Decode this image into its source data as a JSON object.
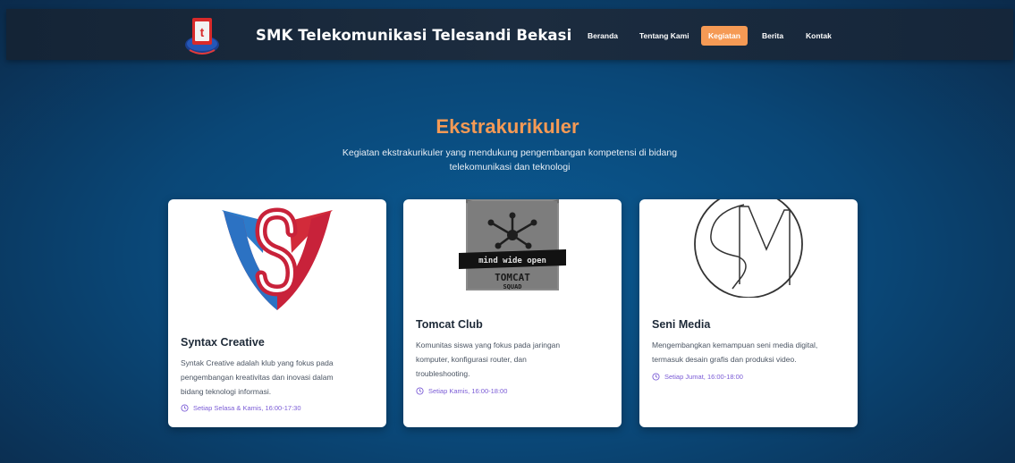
{
  "header": {
    "brand": "SMK Telekomunikasi Telesandi Bekasi",
    "logo_icon": "school-logo-icon",
    "nav": [
      {
        "label": "Beranda",
        "active": false
      },
      {
        "label": "Tentang Kami",
        "active": false
      },
      {
        "label": "Kegiatan",
        "active": true
      },
      {
        "label": "Berita",
        "active": false
      },
      {
        "label": "Kontak",
        "active": false
      }
    ]
  },
  "hero": {
    "title": "Ekstrakurikuler",
    "subtitle_line1": "Kegiatan ekstrakurikuler yang mendukung pengembangan kompetensi di bidang",
    "subtitle_line2": "telekomunikasi dan teknologi"
  },
  "cards": [
    {
      "title": "Syntax Creative",
      "desc_lines": [
        "Syntak Creative adalah klub yang fokus pada",
        "pengembangan kreativitas dan inovasi dalam",
        "bidang teknologi informasi."
      ],
      "schedule": "Setiap Selasa & Kamis, 16:00-17:30",
      "image_icon": "syntax-creative-logo"
    },
    {
      "title": "Tomcat Club",
      "desc_lines": [
        "Komunitas siswa yang fokus pada jaringan",
        "komputer, konfigurasi router, dan",
        "troubleshooting."
      ],
      "schedule": "Setiap Kamis, 16:00-18:00",
      "image_icon": "tomcat-squad-logo",
      "image_text": [
        "mind wide open",
        "TOMCAT",
        "SQUAD"
      ]
    },
    {
      "title": "Seni Media",
      "desc_lines": [
        "Mengembangkan kemampuan seni media digital,",
        "termasuk desain grafis dan produksi video."
      ],
      "schedule": "Setiap Jumat, 16:00-18:00",
      "image_icon": "seni-media-logo"
    }
  ],
  "colors": {
    "accent": "#f59a55",
    "schedule": "#7b5cd6",
    "navbar": "#1a2a3c",
    "background": "#0a4777"
  }
}
